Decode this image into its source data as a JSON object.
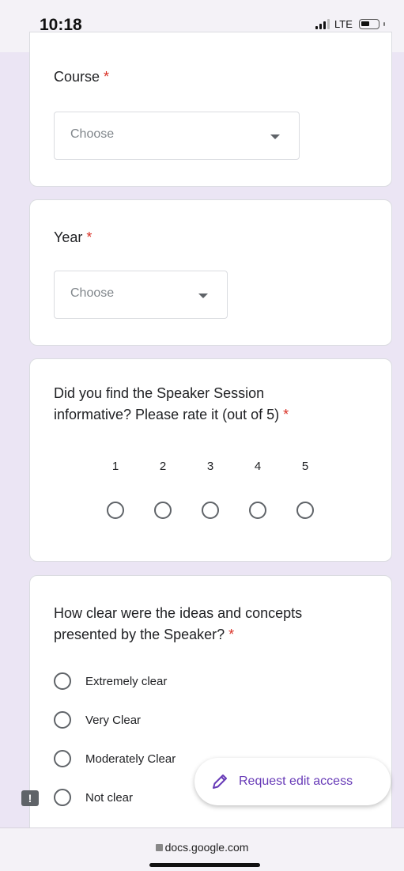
{
  "status_bar": {
    "time": "10:18",
    "network": "LTE"
  },
  "course": {
    "title": "Course",
    "required_mark": "*",
    "placeholder": "Choose"
  },
  "year": {
    "title": "Year",
    "required_mark": "*",
    "placeholder": "Choose"
  },
  "rating": {
    "title": "Did you find the Speaker Session informative? Please rate it (out of 5)",
    "required_mark": "*",
    "scale": [
      "1",
      "2",
      "3",
      "4",
      "5"
    ]
  },
  "clarity": {
    "title": "How clear were the ideas and concepts presented by the Speaker?",
    "required_mark": "*",
    "options": [
      "Extremely clear",
      "Very Clear",
      "Moderately Clear",
      "Not clear"
    ]
  },
  "edit_button": {
    "label": "Request edit access",
    "icon": "pencil-icon"
  },
  "feedback_icon": {
    "glyph": "!"
  },
  "browser": {
    "url": "docs.google.com"
  },
  "colors": {
    "accent": "#673ab7",
    "required": "#d93025",
    "background": "#ebe5f4"
  }
}
